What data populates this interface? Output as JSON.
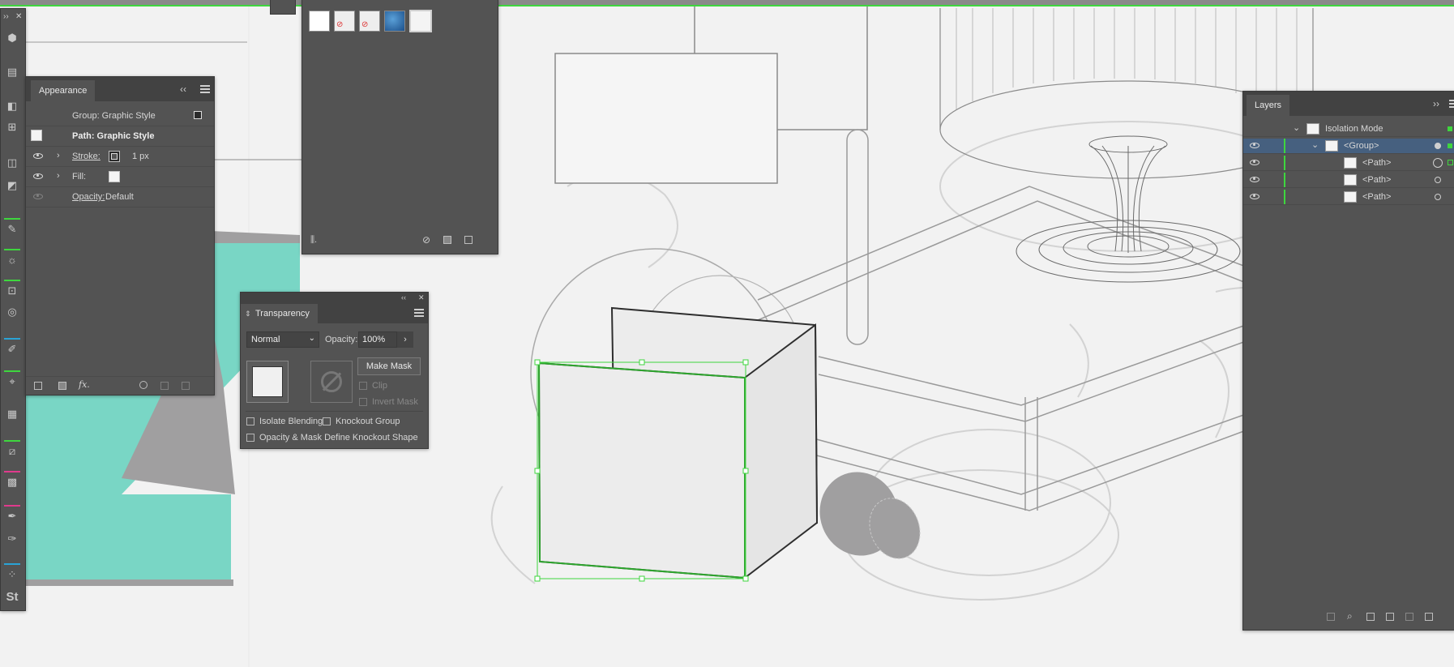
{
  "colors": {
    "selection": "#3ed63e",
    "panel_bg": "#535353",
    "teal": "#79d6c5",
    "gray_shape": "#a09fa0"
  },
  "appearance": {
    "tab": "Appearance",
    "group_row": "Group: Graphic Style",
    "path_row": "Path: Graphic Style",
    "stroke_label": "Stroke:",
    "stroke_value": "1 px",
    "fill_label": "Fill:",
    "opacity_label": "Opacity:",
    "opacity_value": "Default",
    "fx_label": "fx."
  },
  "graphic_styles": {
    "swatches": [
      "default-style",
      "no-fill-style-1",
      "no-fill-style-2",
      "blue-texture-style",
      "selected-style"
    ]
  },
  "transparency": {
    "tab": "Transparency",
    "blend_mode": "Normal",
    "opacity_label": "Opacity:",
    "opacity_value": "100%",
    "make_mask": "Make Mask",
    "clip": "Clip",
    "invert_mask": "Invert Mask",
    "isolate_blending": "Isolate Blending",
    "knockout_group": "Knockout Group",
    "opacity_mask_knockout": "Opacity & Mask Define Knockout Shape"
  },
  "layers": {
    "tab": "Layers",
    "rows": [
      {
        "name": "Isolation Mode",
        "level": 0
      },
      {
        "name": "<Group>",
        "level": 1
      },
      {
        "name": "<Path>",
        "level": 2
      },
      {
        "name": "<Path>",
        "level": 2
      },
      {
        "name": "<Path>",
        "level": 2
      }
    ]
  },
  "toolbar": {
    "stock_label": "St"
  }
}
